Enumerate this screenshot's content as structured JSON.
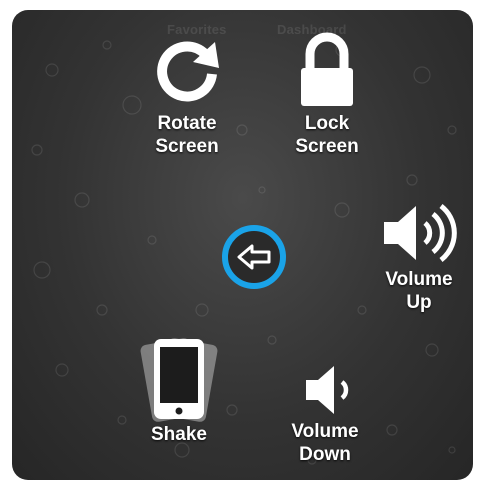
{
  "background_tabs": [
    "Favorites",
    "Dashboard"
  ],
  "actions": {
    "rotate": {
      "line1": "Rotate",
      "line2": "Screen",
      "icon": "rotate-icon"
    },
    "lock": {
      "line1": "Lock",
      "line2": "Screen",
      "icon": "lock-icon"
    },
    "volume_up": {
      "line1": "Volume",
      "line2": "Up",
      "icon": "speaker-loud-icon"
    },
    "volume_down": {
      "line1": "Volume",
      "line2": "Down",
      "icon": "speaker-soft-icon"
    },
    "shake": {
      "line1": "Shake",
      "icon": "phone-shake-icon"
    },
    "back": {
      "icon": "back-arrow-icon"
    }
  },
  "colors": {
    "accent": "#1aa3e8",
    "panel": "#333333",
    "text": "#ffffff"
  }
}
